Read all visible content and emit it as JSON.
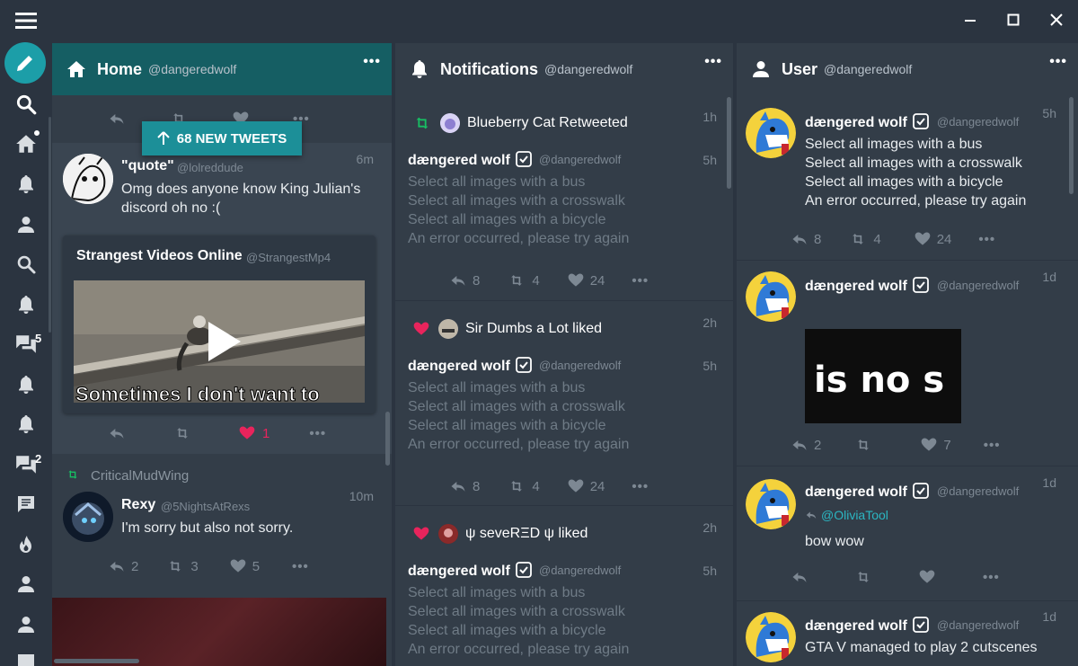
{
  "colors": {
    "teal": "#1c9ea8",
    "header_home": "#155e63",
    "like": "#e8245c",
    "retweet": "#17bf63",
    "dim_text": "#6f7b86",
    "bg": "#2b3440",
    "column": "#333d48"
  },
  "window": {
    "controls": [
      "minimize-icon",
      "maximize-icon",
      "close-icon"
    ]
  },
  "sidebar": {
    "badges": {
      "messages_1": "5",
      "messages_2": "2"
    }
  },
  "home": {
    "title": "Home",
    "user": "@dangeredwolf",
    "new_tweets": "68 NEW TWEETS",
    "tweet1": {
      "name": "\"quote\"",
      "handle": "@lolreddude",
      "time": "6m",
      "text": [
        "Omg does anyone know King Julian's",
        "discord oh no :("
      ],
      "quote_name": "Strangest Videos Online",
      "quote_handle": "@StrangestMp4",
      "video_caption": "Sometimes I don't want to",
      "likes": "1"
    },
    "tweet2": {
      "retweeter": "CriticalMudWing",
      "name": "Rexy",
      "handle": "@5NightsAtRexs",
      "time": "10m",
      "text": "I'm sorry but also not sorry.",
      "replies": "2",
      "retweets": "3",
      "likes": "5"
    }
  },
  "notifications": {
    "title": "Notifications",
    "user": "@dangeredwolf",
    "items": [
      {
        "action": "Blueberry Cat Retweeted",
        "action_time": "1h",
        "type": "retweet"
      },
      {
        "action": "Sir Dumbs a Lot liked",
        "action_time": "2h",
        "type": "like"
      },
      {
        "action": "ψ sеvеRΞD ψ liked",
        "action_time": "2h",
        "type": "like"
      }
    ],
    "tweet": {
      "name": "dængered wolf",
      "handle": "@dangeredwolf",
      "time": "5h",
      "text": [
        "Select all images with a bus",
        "Select all images with a crosswalk",
        "Select all images with a bicycle",
        "An error occurred, please try again"
      ],
      "replies": "8",
      "retweets": "4",
      "likes": "24"
    }
  },
  "user": {
    "title": "User",
    "user": "@dangeredwolf",
    "tweets": [
      {
        "name": "dængered wolf",
        "handle": "@dangeredwolf",
        "time": "5h",
        "text": [
          "Select all images with a bus",
          "Select all images with a crosswalk",
          "Select all images with a bicycle",
          "An error occurred, please try again"
        ],
        "replies": "8",
        "retweets": "4",
        "likes": "24"
      },
      {
        "name": "dængered wolf",
        "handle": "@dangeredwolf",
        "time": "1d",
        "image_text": "is no s",
        "replies": "2",
        "likes": "7"
      },
      {
        "name": "dængered wolf",
        "handle": "@dangeredwolf",
        "time": "1d",
        "reply_to": "@OliviaTool",
        "text": "bow wow"
      },
      {
        "name": "dængered wolf",
        "handle": "@dangeredwolf",
        "time": "1d",
        "text": "GTA V managed to play 2 cutscenes"
      }
    ]
  }
}
